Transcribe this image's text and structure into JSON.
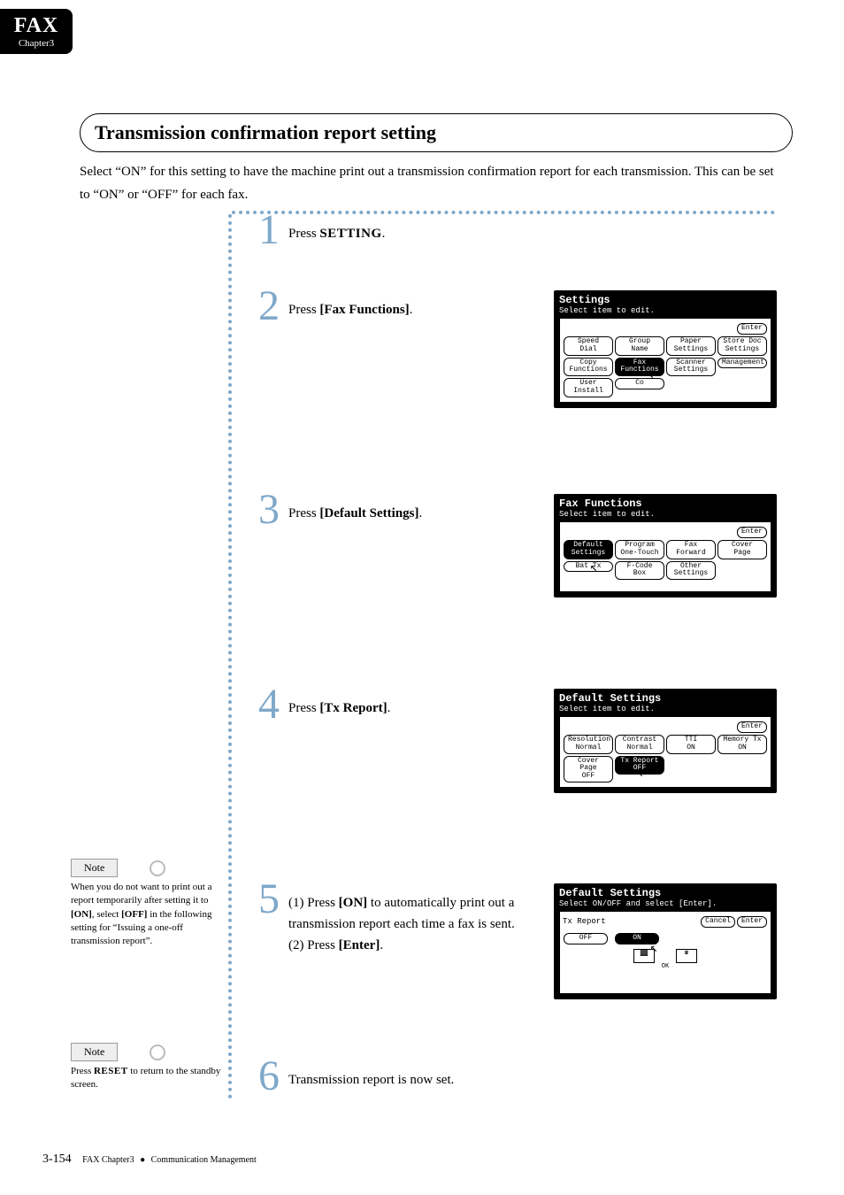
{
  "tab": {
    "big": "FAX",
    "small": "Chapter3"
  },
  "section_title": "Transmission confirmation report setting",
  "intro": "Select “ON” for this setting to have the machine print out a transmission confirmation report for each transmission. This can be set to “ON” or “OFF” for each fax.",
  "steps": {
    "s1": {
      "n": "1",
      "pre": "Press ",
      "key": "SETTING",
      "post": "."
    },
    "s2": {
      "n": "2",
      "pre": "Press ",
      "bold": "[Fax Functions]",
      "post": "."
    },
    "s3": {
      "n": "3",
      "pre": "Press ",
      "bold": "[Default Settings]",
      "post": "."
    },
    "s4": {
      "n": "4",
      "pre": "Press ",
      "bold": "[Tx Report]",
      "post": "."
    },
    "s5": {
      "n": "5",
      "l1a": "(1) Press ",
      "l1b": "[ON]",
      "l1c": " to automatically print out a transmission report each time a fax is sent.",
      "l2a": "(2) Press ",
      "l2b": "[Enter]",
      "l2c": "."
    },
    "s6": {
      "n": "6",
      "text": "Transmission report is now set."
    }
  },
  "lcd2": {
    "title": "Settings",
    "sub": "Select item to edit.",
    "enter": "Enter",
    "b": [
      "Speed Dial",
      "Group Name",
      "Paper Settings",
      "Store Doc Settings",
      "Copy Functions",
      "Fax Functions",
      "Scanner Settings",
      "Management",
      "User Install",
      "Co"
    ]
  },
  "lcd3": {
    "title": "Fax Functions",
    "sub": "Select item to edit.",
    "enter": "Enter",
    "b": [
      "Default Settings",
      "Program One-Touch",
      "Fax Forward",
      "Cover Page",
      "Bat   Tx",
      "F-Code Box",
      "Other Settings"
    ]
  },
  "lcd4": {
    "title": "Default Settings",
    "sub": "Select item to edit.",
    "enter": "Enter",
    "b": [
      [
        "Resolution",
        "Normal"
      ],
      [
        "Contrast",
        "Normal"
      ],
      [
        "TTI",
        "ON"
      ],
      [
        "Memory Tx",
        "ON"
      ],
      [
        "Cover Page",
        "OFF"
      ],
      [
        "Tx Report",
        "OFF"
      ]
    ]
  },
  "lcd5": {
    "title": "Default Settings",
    "sub": "Select ON/OFF and select [Enter].",
    "enter": "Enter",
    "cancel": "Cancel",
    "label": "Tx Report",
    "off": "OFF",
    "on": "ON",
    "ok": "OK"
  },
  "note5": {
    "label": "Note",
    "text_a": "When you do not want to print out a report  temporarily after setting it to ",
    "b1": "[ON]",
    "text_b": ", select ",
    "b2": "[OFF]",
    "text_c": " in the following setting for “Issuing a one-off transmission report”."
  },
  "note6": {
    "label": "Note",
    "text_a": "Press ",
    "key": "RESET",
    "text_b": " to return to the standby screen."
  },
  "footer": {
    "page": "3-154",
    "a": "FAX Chapter3",
    "b": "Communication Management"
  }
}
